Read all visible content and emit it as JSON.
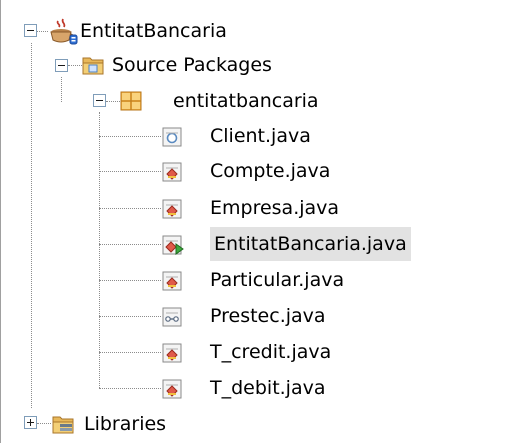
{
  "tree": {
    "project": {
      "label": "EntitatBancaria",
      "icon": "java-project-icon",
      "expanded": true
    },
    "source_packages": {
      "label": "Source Packages",
      "icon": "source-folder-icon",
      "expanded": true
    },
    "package": {
      "label": "entitatbancaria",
      "icon": "package-icon",
      "expanded": true
    },
    "files": [
      {
        "label": "Client.java",
        "icon": "java-interface-icon"
      },
      {
        "label": "Compte.java",
        "icon": "java-class-icon"
      },
      {
        "label": "Empresa.java",
        "icon": "java-class-icon"
      },
      {
        "label": "EntitatBancaria.java",
        "icon": "java-main-class-icon",
        "selected": true
      },
      {
        "label": "Particular.java",
        "icon": "java-class-icon"
      },
      {
        "label": "Prestec.java",
        "icon": "java-enum-icon"
      },
      {
        "label": "T_credit.java",
        "icon": "java-class-icon"
      },
      {
        "label": "T_debit.java",
        "icon": "java-class-icon"
      }
    ],
    "libraries": {
      "label": "Libraries",
      "icon": "libraries-icon",
      "expanded": false
    }
  },
  "colors": {
    "selection": "#e2e2e2",
    "folder": "#e8b85a",
    "package": "#e8a030",
    "java_badge": "#d06050"
  }
}
